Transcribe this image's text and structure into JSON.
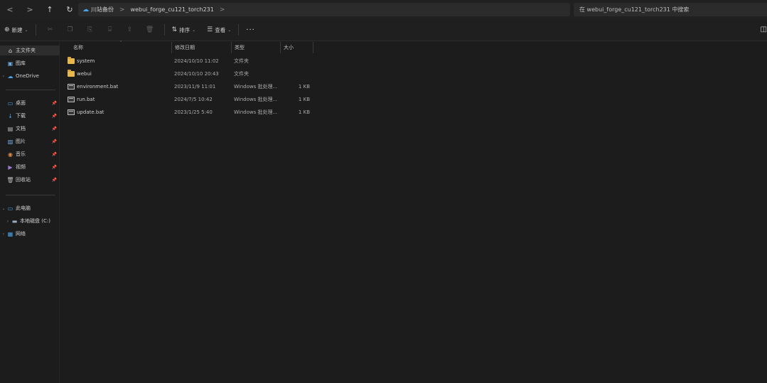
{
  "nav": {
    "back": "<",
    "forward": ">",
    "up": "↑",
    "refresh": "↻"
  },
  "address": {
    "root": "川站备份",
    "folder": "webui_forge_cu121_torch231",
    "sep": ">"
  },
  "search": {
    "placeholder": "在 webui_forge_cu121_torch231 中搜索"
  },
  "toolbar": {
    "new_label": "新建",
    "sort_label": "排序",
    "view_label": "查看",
    "more_label": "···"
  },
  "sidebar": {
    "items": [
      {
        "label": "主文件夹",
        "icon": "home-icon"
      },
      {
        "label": "图库",
        "icon": "gallery-icon"
      },
      {
        "label": "OneDrive",
        "icon": "cloud-icon"
      },
      {
        "label": "桌面",
        "icon": "desktop-icon"
      },
      {
        "label": "下载",
        "icon": "download-icon"
      },
      {
        "label": "文档",
        "icon": "document-icon"
      },
      {
        "label": "图片",
        "icon": "picture-icon"
      },
      {
        "label": "音乐",
        "icon": "music-icon"
      },
      {
        "label": "视频",
        "icon": "video-icon"
      },
      {
        "label": "回收站",
        "icon": "recycle-bin-icon"
      },
      {
        "label": "此电脑",
        "icon": "this-pc-icon"
      },
      {
        "label": "本地磁盘 (C:)",
        "icon": "drive-icon"
      },
      {
        "label": "网络",
        "icon": "network-icon"
      }
    ]
  },
  "columns": {
    "name": "名称",
    "modified": "修改日期",
    "type": "类型",
    "size": "大小"
  },
  "files": [
    {
      "name": "system",
      "modified": "2024/10/10 11:02",
      "type": "文件夹",
      "size": "",
      "kind": "folder"
    },
    {
      "name": "webui",
      "modified": "2024/10/10 20:43",
      "type": "文件夹",
      "size": "",
      "kind": "folder"
    },
    {
      "name": "environment.bat",
      "modified": "2023/11/9 11:01",
      "type": "Windows 批处理...",
      "size": "1 KB",
      "kind": "bat"
    },
    {
      "name": "run.bat",
      "modified": "2024/7/5 10:42",
      "type": "Windows 批处理...",
      "size": "1 KB",
      "kind": "bat"
    },
    {
      "name": "update.bat",
      "modified": "2023/1/25 5:40",
      "type": "Windows 批处理...",
      "size": "1 KB",
      "kind": "bat"
    }
  ],
  "colors": {
    "background": "#1c1c1c",
    "folder": "#e8b84a",
    "onedrive": "#4aa3e8"
  }
}
